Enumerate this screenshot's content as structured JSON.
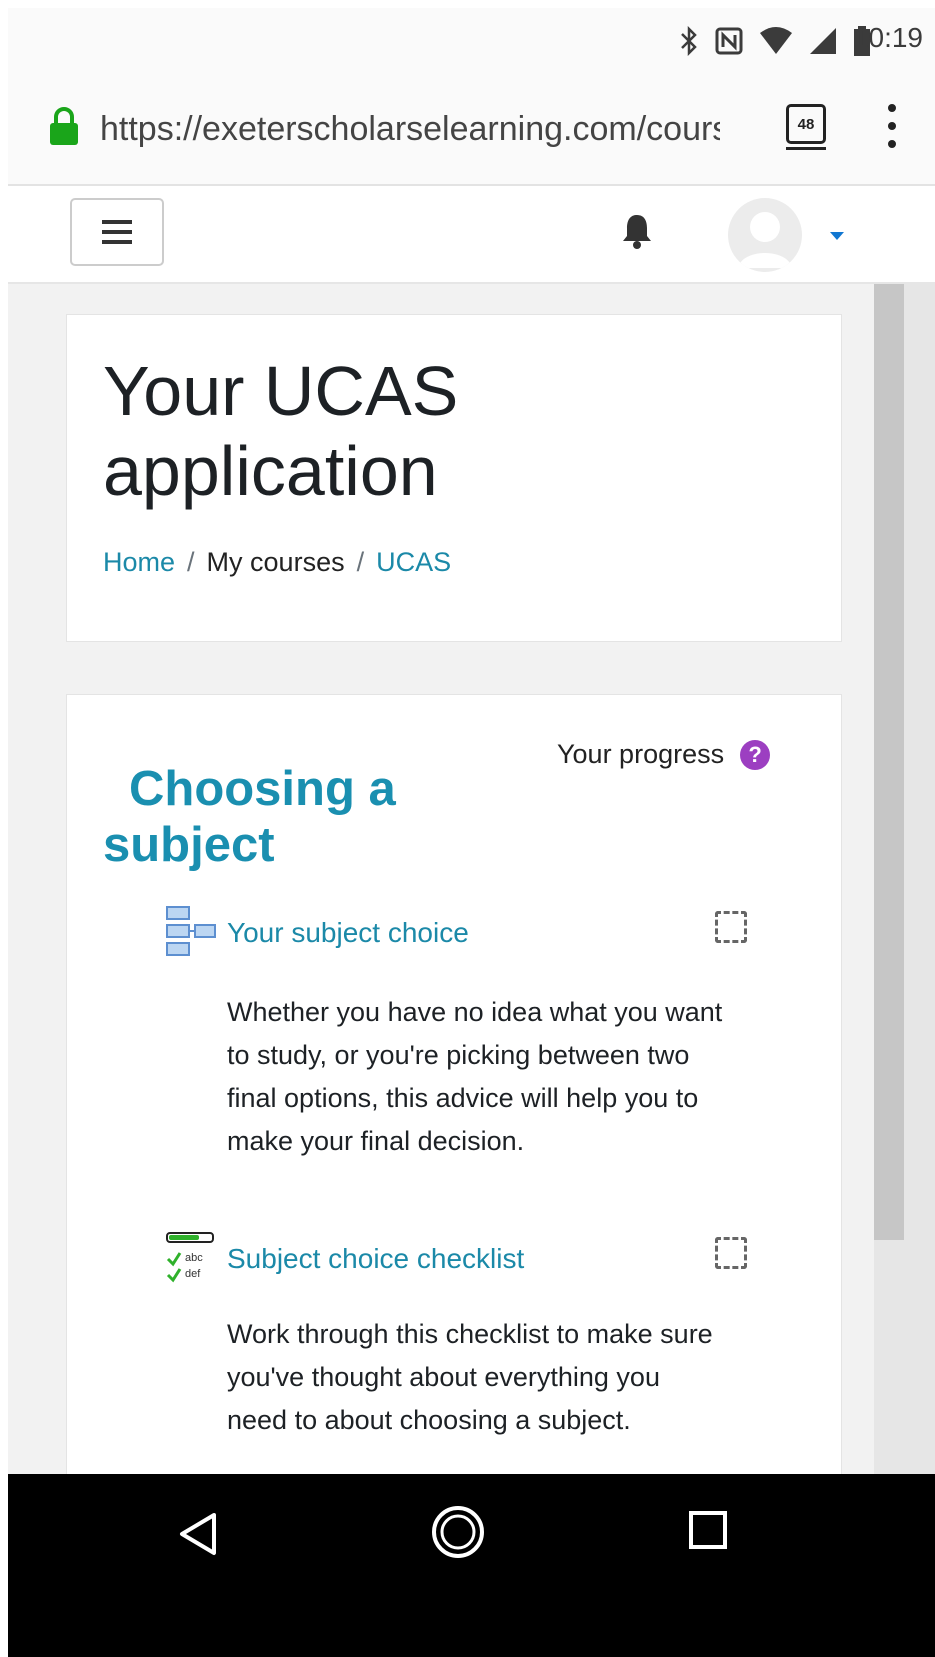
{
  "status_bar": {
    "time": "10:19",
    "icons": [
      "bluetooth-icon",
      "nfc-icon",
      "wifi-icon",
      "signal-icon",
      "battery-icon"
    ]
  },
  "browser": {
    "url": "https://exeterscholarselearning.com/course/view.php",
    "tab_count": "48"
  },
  "page": {
    "title": "Your UCAS application",
    "breadcrumb": [
      {
        "label": "Home",
        "link": true
      },
      {
        "label": "My courses",
        "link": false
      },
      {
        "label": "UCAS",
        "link": true
      }
    ]
  },
  "section": {
    "title": "Choosing a subject",
    "progress_label": "Your progress",
    "help_glyph": "?",
    "activities": [
      {
        "name": "Your subject choice",
        "description": "Whether you have no idea what you want to study, or you're picking between two final options, this advice will help you to make your final decision.",
        "icon": "book-structure-icon",
        "completed": false
      },
      {
        "name": "Subject choice checklist",
        "description": "Work through this checklist to make sure you've thought about everything you need to about choosing a subject.",
        "icon": "checklist-icon",
        "icon_text_top": "abc",
        "icon_text_bottom": "def",
        "completed": false
      }
    ]
  },
  "colors": {
    "link": "#1b89a8",
    "heading_accent": "#1a8fb0",
    "help": "#9c3fc1",
    "progress_green": "#2fb12b"
  }
}
